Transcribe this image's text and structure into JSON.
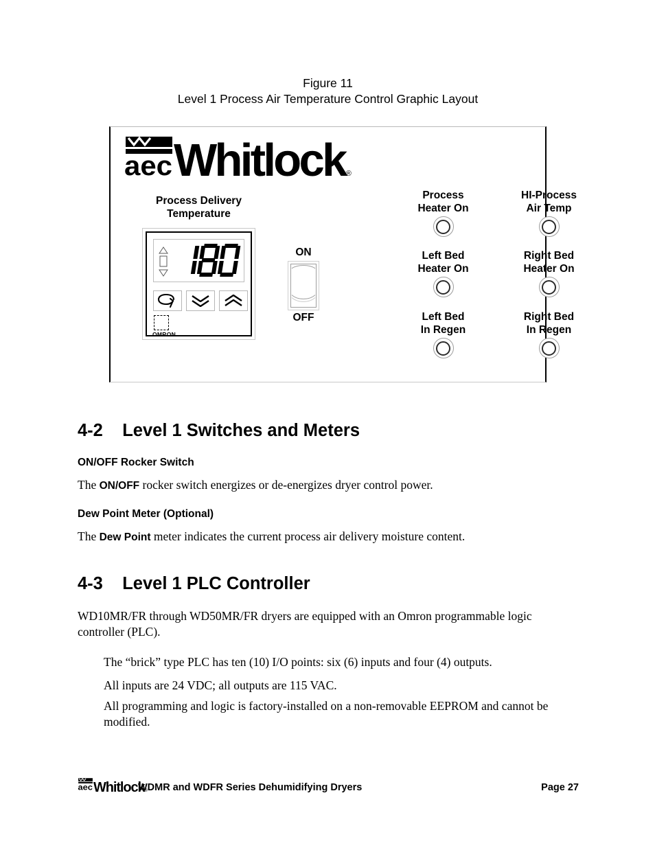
{
  "figure": {
    "caption_line1": "Figure 11",
    "caption_line2": "Level 1 Process Air Temperature Control Graphic Layout",
    "panel": {
      "brand_word": "Whitlock",
      "brand_mark": "aec",
      "registered": "®",
      "controller": {
        "label": "Process Delivery\nTemperature",
        "display_value": "180",
        "maker": "OMRON",
        "buttons": [
          {
            "name": "mode-loop",
            "glyph": "loop"
          },
          {
            "name": "down",
            "glyph": "double-chevron-down"
          },
          {
            "name": "up",
            "glyph": "double-chevron-up"
          }
        ]
      },
      "rocker": {
        "on_label": "ON",
        "off_label": "OFF"
      },
      "indicators": [
        {
          "label": "Process\nHeater On",
          "state": "off"
        },
        {
          "label": "HI-Process\nAir Temp",
          "state": "off"
        },
        {
          "label": "Left Bed\nHeater On",
          "state": "off"
        },
        {
          "label": "Right Bed\nHeater On",
          "state": "off"
        },
        {
          "label": "Left Bed\nIn Regen",
          "state": "off"
        },
        {
          "label": "Right Bed\nIn Regen",
          "state": "off"
        }
      ]
    }
  },
  "sections": [
    {
      "number": "4-2",
      "title": "Level 1 Switches and Meters",
      "subsections": [
        {
          "heading": "ON/OFF Rocker Switch",
          "body_pre": "The ",
          "body_bold": "ON/OFF",
          "body_post": " rocker switch energizes or de-energizes dryer control power."
        },
        {
          "heading": "Dew Point Meter (Optional)",
          "body_pre": "The ",
          "body_bold": "Dew Point",
          "body_post": " meter indicates the current process air delivery moisture content."
        }
      ]
    },
    {
      "number": "4-3",
      "title": "Level 1 PLC Controller",
      "intro": "WD10MR/FR through WD50MR/FR dryers are equipped with an Omron programmable logic controller (PLC).",
      "bullets": [
        "The “brick” type PLC has ten (10) I/O points: six (6) inputs and four (4) outputs.",
        "All inputs are 24 VDC; all outputs are 115 VAC.",
        "All programming and logic is factory-installed on a non-removable EEPROM and cannot be modified."
      ]
    }
  ],
  "footer": {
    "brand_word": "Whitlock",
    "brand_mark": "aec",
    "registered": "®",
    "title": "WDMR and WDFR Series Dehumidifying Dryers",
    "page": "Page 27"
  },
  "colors": {
    "text": "#000000",
    "rule_light": "#c0c0c0",
    "rule_dark": "#000000"
  }
}
